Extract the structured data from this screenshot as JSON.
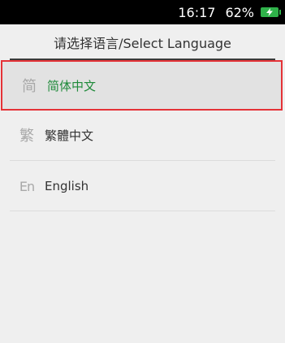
{
  "status_bar": {
    "time": "16:17",
    "battery_percent": "62%",
    "battery_icon": "battery-charging-icon",
    "battery_color": "#2fb24a"
  },
  "header": {
    "title": "请选择语言/Select Language"
  },
  "languages": [
    {
      "icon_text": "简",
      "label": "简体中文",
      "selected": true
    },
    {
      "icon_text": "繁",
      "label": "繁體中文",
      "selected": false
    },
    {
      "icon_text": "En",
      "label": "English",
      "selected": false
    }
  ],
  "colors": {
    "selected_label": "#1f8a3a",
    "selection_border": "#e53237",
    "background": "#efefef"
  }
}
